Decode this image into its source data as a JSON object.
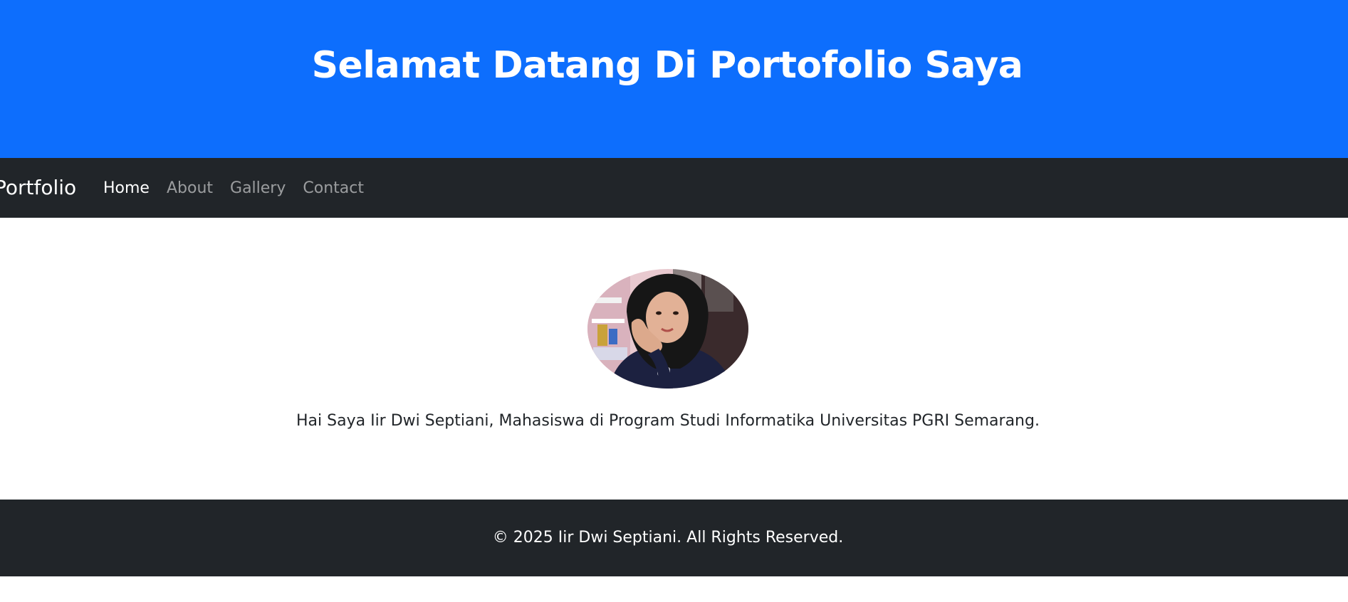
{
  "header": {
    "title": "Selamat Datang Di Portofolio Saya"
  },
  "navbar": {
    "brand": "Portfolio",
    "links": [
      {
        "label": "Home",
        "active": true
      },
      {
        "label": "About",
        "active": false
      },
      {
        "label": "Gallery",
        "active": false
      },
      {
        "label": "Contact",
        "active": false
      }
    ]
  },
  "main": {
    "intro": "Hai Saya Iir Dwi Septiani, Mahasiswa di Program Studi Informatika Universitas PGRI Semarang."
  },
  "footer": {
    "text": "© 2025 Iir Dwi Septiani. All Rights Reserved."
  },
  "colors": {
    "hero_bg": "#0d6efd",
    "navbar_bg": "#212529",
    "footer_bg": "#212529",
    "nav_active": "#ffffff",
    "nav_inactive": "#8f9194"
  }
}
